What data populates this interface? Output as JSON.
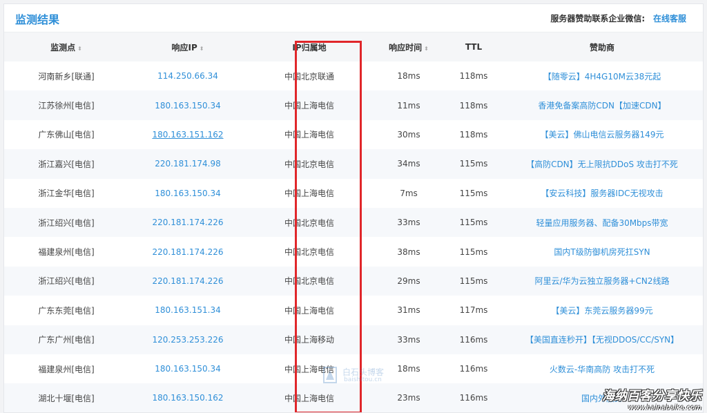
{
  "header": {
    "title": "监测结果",
    "sponsor_label": "服务器赞助联系企业微信:",
    "sponsor_link": "在线客服"
  },
  "table": {
    "columns": [
      {
        "label": "监测点",
        "sortable": true
      },
      {
        "label": "响应IP",
        "sortable": true
      },
      {
        "label": "IP归属地",
        "sortable": false
      },
      {
        "label": "响应时间",
        "sortable": true
      },
      {
        "label": "TTL",
        "sortable": false
      },
      {
        "label": "赞助商",
        "sortable": false
      }
    ],
    "sort_glyph": "⬍",
    "rows": [
      {
        "node": "河南新乡[联通]",
        "ip": "114.250.66.34",
        "location": "中国北京联通",
        "time": "18ms",
        "ttl": "118ms",
        "sponsor": "【随零云】4H4G10M云38元起"
      },
      {
        "node": "江苏徐州[电信]",
        "ip": "180.163.150.34",
        "location": "中国上海电信",
        "time": "11ms",
        "ttl": "118ms",
        "sponsor": "香港免备案高防CDN【加速CDN】"
      },
      {
        "node": "广东佛山[电信]",
        "ip": "180.163.151.162",
        "location": "中国上海电信",
        "time": "30ms",
        "ttl": "118ms",
        "sponsor": "【美云】佛山电信云服务器149元"
      },
      {
        "node": "浙江嘉兴[电信]",
        "ip": "220.181.174.98",
        "location": "中国北京电信",
        "time": "34ms",
        "ttl": "115ms",
        "sponsor": "【高防CDN】无上限抗DDoS 攻击打不死"
      },
      {
        "node": "浙江金华[电信]",
        "ip": "180.163.150.34",
        "location": "中国上海电信",
        "time": "7ms",
        "ttl": "115ms",
        "sponsor": "【安云科技】服务器IDC无视攻击"
      },
      {
        "node": "浙江绍兴[电信]",
        "ip": "220.181.174.226",
        "location": "中国北京电信",
        "time": "33ms",
        "ttl": "115ms",
        "sponsor": "轻量应用服务器、配备30Mbps带宽"
      },
      {
        "node": "福建泉州[电信]",
        "ip": "220.181.174.226",
        "location": "中国北京电信",
        "time": "38ms",
        "ttl": "115ms",
        "sponsor": "国内T级防御机房死扛SYN"
      },
      {
        "node": "浙江绍兴[电信]",
        "ip": "220.181.174.226",
        "location": "中国北京电信",
        "time": "29ms",
        "ttl": "115ms",
        "sponsor": "阿里云/华为云独立服务器+CN2线路"
      },
      {
        "node": "广东东莞[电信]",
        "ip": "180.163.151.34",
        "location": "中国上海电信",
        "time": "31ms",
        "ttl": "117ms",
        "sponsor": "【美云】东莞云服务器99元"
      },
      {
        "node": "广东广州[电信]",
        "ip": "120.253.253.226",
        "location": "中国上海移动",
        "time": "33ms",
        "ttl": "116ms",
        "sponsor": "【美国直连秒开】【无视DDOS/CC/SYN】"
      },
      {
        "node": "福建泉州[电信]",
        "ip": "180.163.150.34",
        "location": "中国上海电信",
        "time": "18ms",
        "ttl": "116ms",
        "sponsor": "火数云-华南高防 攻击打不死"
      },
      {
        "node": "湖北十堰[电信]",
        "ip": "180.163.150.162",
        "location": "中国上海电信",
        "time": "23ms",
        "ttl": "116ms",
        "sponsor": "国内外服务"
      }
    ]
  },
  "watermarks": {
    "center_text": "白石头博客",
    "center_sub": "baishitou.cn",
    "corner_text": "海纳百客分享快乐",
    "corner_sub": "www.hainabaike.com"
  },
  "colors": {
    "accent": "#2f8fd8",
    "highlight_box": "#e0262a"
  }
}
